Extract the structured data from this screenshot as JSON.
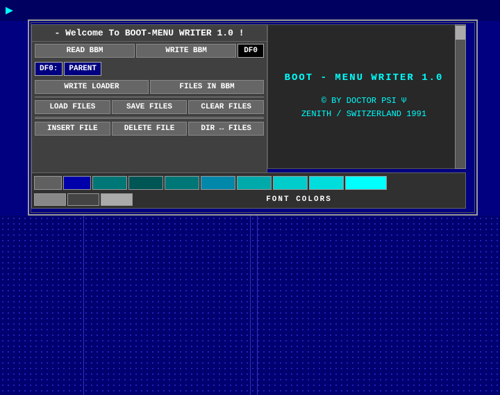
{
  "topbar": {
    "icon": "▶"
  },
  "window": {
    "welcome": "- Welcome To BOOT-MENU WRITER 1.0 !",
    "buttons": {
      "read_bbm": "READ BBM",
      "write_bbm": "WRITE BBM",
      "df0": "DF0",
      "df0_label": "DF0:",
      "parent": "PARENT",
      "write_loader": "WRITE LOADER",
      "files_in_bbm": "FILES IN BBM",
      "load_files": "LOAD FILES",
      "save_files": "SAVE FILES",
      "clear_files": "CLEAR FILES",
      "insert_file": "INSERT FILE",
      "delete_file": "DELETE FILE",
      "dir_files": "DIR ↔ FILES"
    },
    "right_panel": {
      "title": "BOOT - MENU  WRITER  1.0",
      "copy1": "© BY DOCTOR PSI Ψ",
      "copy2": "ZENITH / SWITZERLAND 1991"
    },
    "colors": {
      "label": "FONT COLORS",
      "swatches_top": [
        "#606060",
        "#0000aa",
        "#008888",
        "#004444",
        "#008888",
        "#0088aa",
        "#00aaaa",
        "#00cccc",
        "#00eeee",
        "#00ffff"
      ],
      "swatches_bottom": [
        "#808080",
        "#555555",
        "#aaaaaa"
      ]
    }
  },
  "bottom": {
    "dotted": true
  }
}
